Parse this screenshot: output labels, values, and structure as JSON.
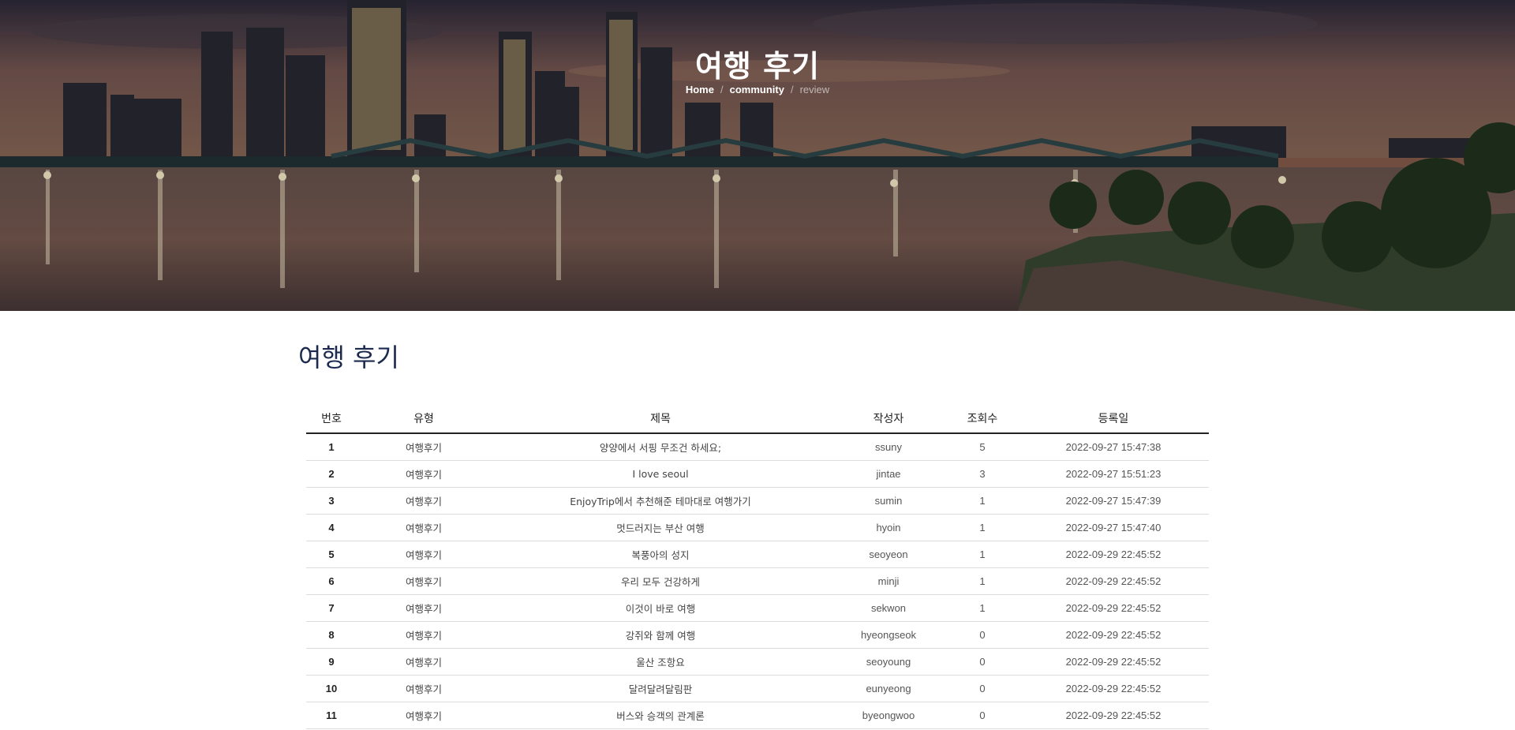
{
  "hero": {
    "title": "여행 후기",
    "breadcrumb": {
      "home": "Home",
      "community": "community",
      "current": "review"
    }
  },
  "page": {
    "heading": "여행 후기"
  },
  "table": {
    "columns": [
      "번호",
      "유형",
      "제목",
      "작성자",
      "조회수",
      "등록일"
    ],
    "rows": [
      {
        "no": "1",
        "type": "여행후기",
        "title": "양양에서 서핑 무조건 하세요;",
        "author": "ssuny",
        "views": "5",
        "date": "2022-09-27 15:47:38"
      },
      {
        "no": "2",
        "type": "여행후기",
        "title": "I love seoul",
        "author": "jintae",
        "views": "3",
        "date": "2022-09-27 15:51:23"
      },
      {
        "no": "3",
        "type": "여행후기",
        "title": "EnjoyTrip에서 추천해준 테마대로 여행가기",
        "author": "sumin",
        "views": "1",
        "date": "2022-09-27 15:47:39"
      },
      {
        "no": "4",
        "type": "여행후기",
        "title": "멋드러지는 부산 여행",
        "author": "hyoin",
        "views": "1",
        "date": "2022-09-27 15:47:40"
      },
      {
        "no": "5",
        "type": "여행후기",
        "title": "복풍아의 성지",
        "author": "seoyeon",
        "views": "1",
        "date": "2022-09-29 22:45:52"
      },
      {
        "no": "6",
        "type": "여행후기",
        "title": "우리 모두 건강하게",
        "author": "minji",
        "views": "1",
        "date": "2022-09-29 22:45:52"
      },
      {
        "no": "7",
        "type": "여행후기",
        "title": "이것이 바로 여행",
        "author": "sekwon",
        "views": "1",
        "date": "2022-09-29 22:45:52"
      },
      {
        "no": "8",
        "type": "여행후기",
        "title": "강쥐와 함께 여행",
        "author": "hyeongseok",
        "views": "0",
        "date": "2022-09-29 22:45:52"
      },
      {
        "no": "9",
        "type": "여행후기",
        "title": "울산 조항요",
        "author": "seoyoung",
        "views": "0",
        "date": "2022-09-29 22:45:52"
      },
      {
        "no": "10",
        "type": "여행후기",
        "title": "달려달려달림판",
        "author": "eunyeong",
        "views": "0",
        "date": "2022-09-29 22:45:52"
      },
      {
        "no": "11",
        "type": "여행후기",
        "title": "버스와 승객의 관계론",
        "author": "byeongwoo",
        "views": "0",
        "date": "2022-09-29 22:45:52"
      }
    ]
  },
  "colors": {
    "heading": "#1b2a4e",
    "rule": "#222222",
    "row_border": "#dcdcdc"
  }
}
